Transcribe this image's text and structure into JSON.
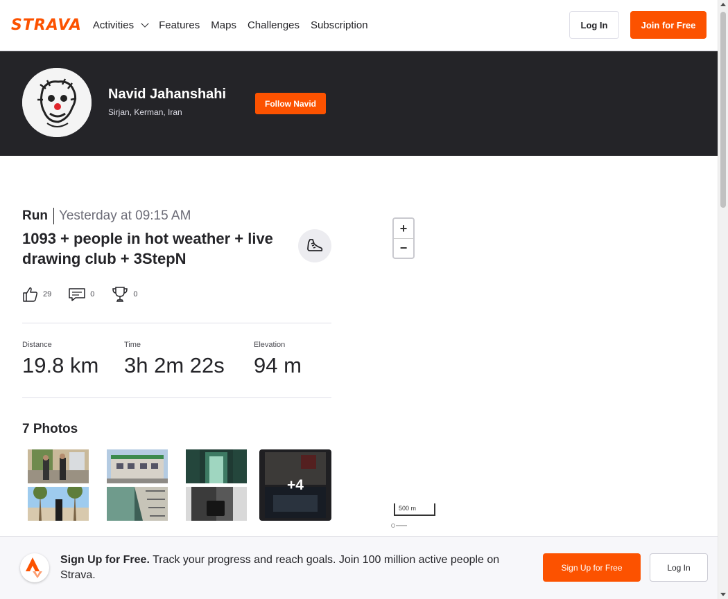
{
  "nav": {
    "logo": "STRAVA",
    "items": [
      {
        "label": "Activities"
      },
      {
        "label": "Features"
      },
      {
        "label": "Maps"
      },
      {
        "label": "Challenges"
      },
      {
        "label": "Subscription"
      }
    ],
    "login_label": "Log In",
    "join_label": "Join for Free"
  },
  "athlete": {
    "name": "Navid Jahanshahi",
    "location": "Sirjan, Kerman, Iran",
    "follow_label": "Follow Navid"
  },
  "activity": {
    "type": "Run",
    "date": "Yesterday at 09:15 AM",
    "title": "1093 + people in hot weather + live drawing club + 3StepN",
    "kudos": "29",
    "comments": "0",
    "achievements": "0",
    "stats": [
      {
        "label": "Distance",
        "value": "19.8 km"
      },
      {
        "label": "Time",
        "value": "3h 2m 22s"
      },
      {
        "label": "Elevation",
        "value": "94 m"
      }
    ],
    "photos_title": "7 Photos",
    "more_photos": "+4"
  },
  "map": {
    "zoom_in": "+",
    "zoom_out": "−",
    "scale": "500 m"
  },
  "banner": {
    "headline": "Sign Up for Free.",
    "body": "Track your progress and reach goals. Join 100 million active people on Strava.",
    "signup_label": "Sign Up for Free",
    "login_label": "Log In"
  },
  "colors": {
    "brand": "#fc5200",
    "header_bg": "#242428"
  }
}
